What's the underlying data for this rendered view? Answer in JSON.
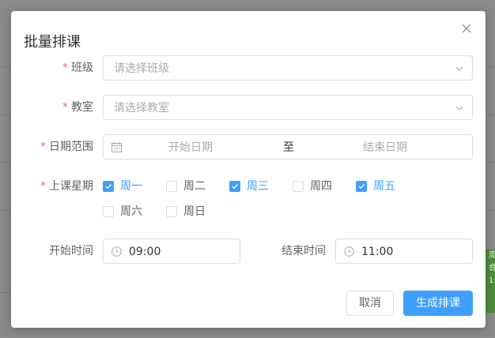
{
  "dialog": {
    "title": "批量排课",
    "close_icon": "close-icon"
  },
  "form": {
    "class": {
      "label": "班级",
      "placeholder": "请选择班级",
      "required": true
    },
    "room": {
      "label": "教室",
      "placeholder": "请选择教室",
      "required": true
    },
    "date_range": {
      "label": "日期范围",
      "required": true,
      "start_placeholder": "开始日期",
      "separator": "至",
      "end_placeholder": "结束日期"
    },
    "weekdays": {
      "label": "上课星期",
      "required": true,
      "options": [
        {
          "label": "周一",
          "checked": true
        },
        {
          "label": "周二",
          "checked": false
        },
        {
          "label": "周三",
          "checked": true
        },
        {
          "label": "周四",
          "checked": false
        },
        {
          "label": "周五",
          "checked": true
        },
        {
          "label": "周六",
          "checked": false
        },
        {
          "label": "周日",
          "checked": false
        }
      ]
    },
    "start_time": {
      "label": "开始时间",
      "value": "09:00"
    },
    "end_time": {
      "label": "结束时间",
      "value": "11:00"
    }
  },
  "footer": {
    "cancel_label": "取消",
    "submit_label": "生成排课"
  },
  "colors": {
    "primary": "#409eff",
    "required": "#f56c6c",
    "placeholder": "#a8abb2",
    "border": "#dcdfe6"
  },
  "background": {
    "side_text": [
      "周",
      "合",
      "1"
    ]
  }
}
